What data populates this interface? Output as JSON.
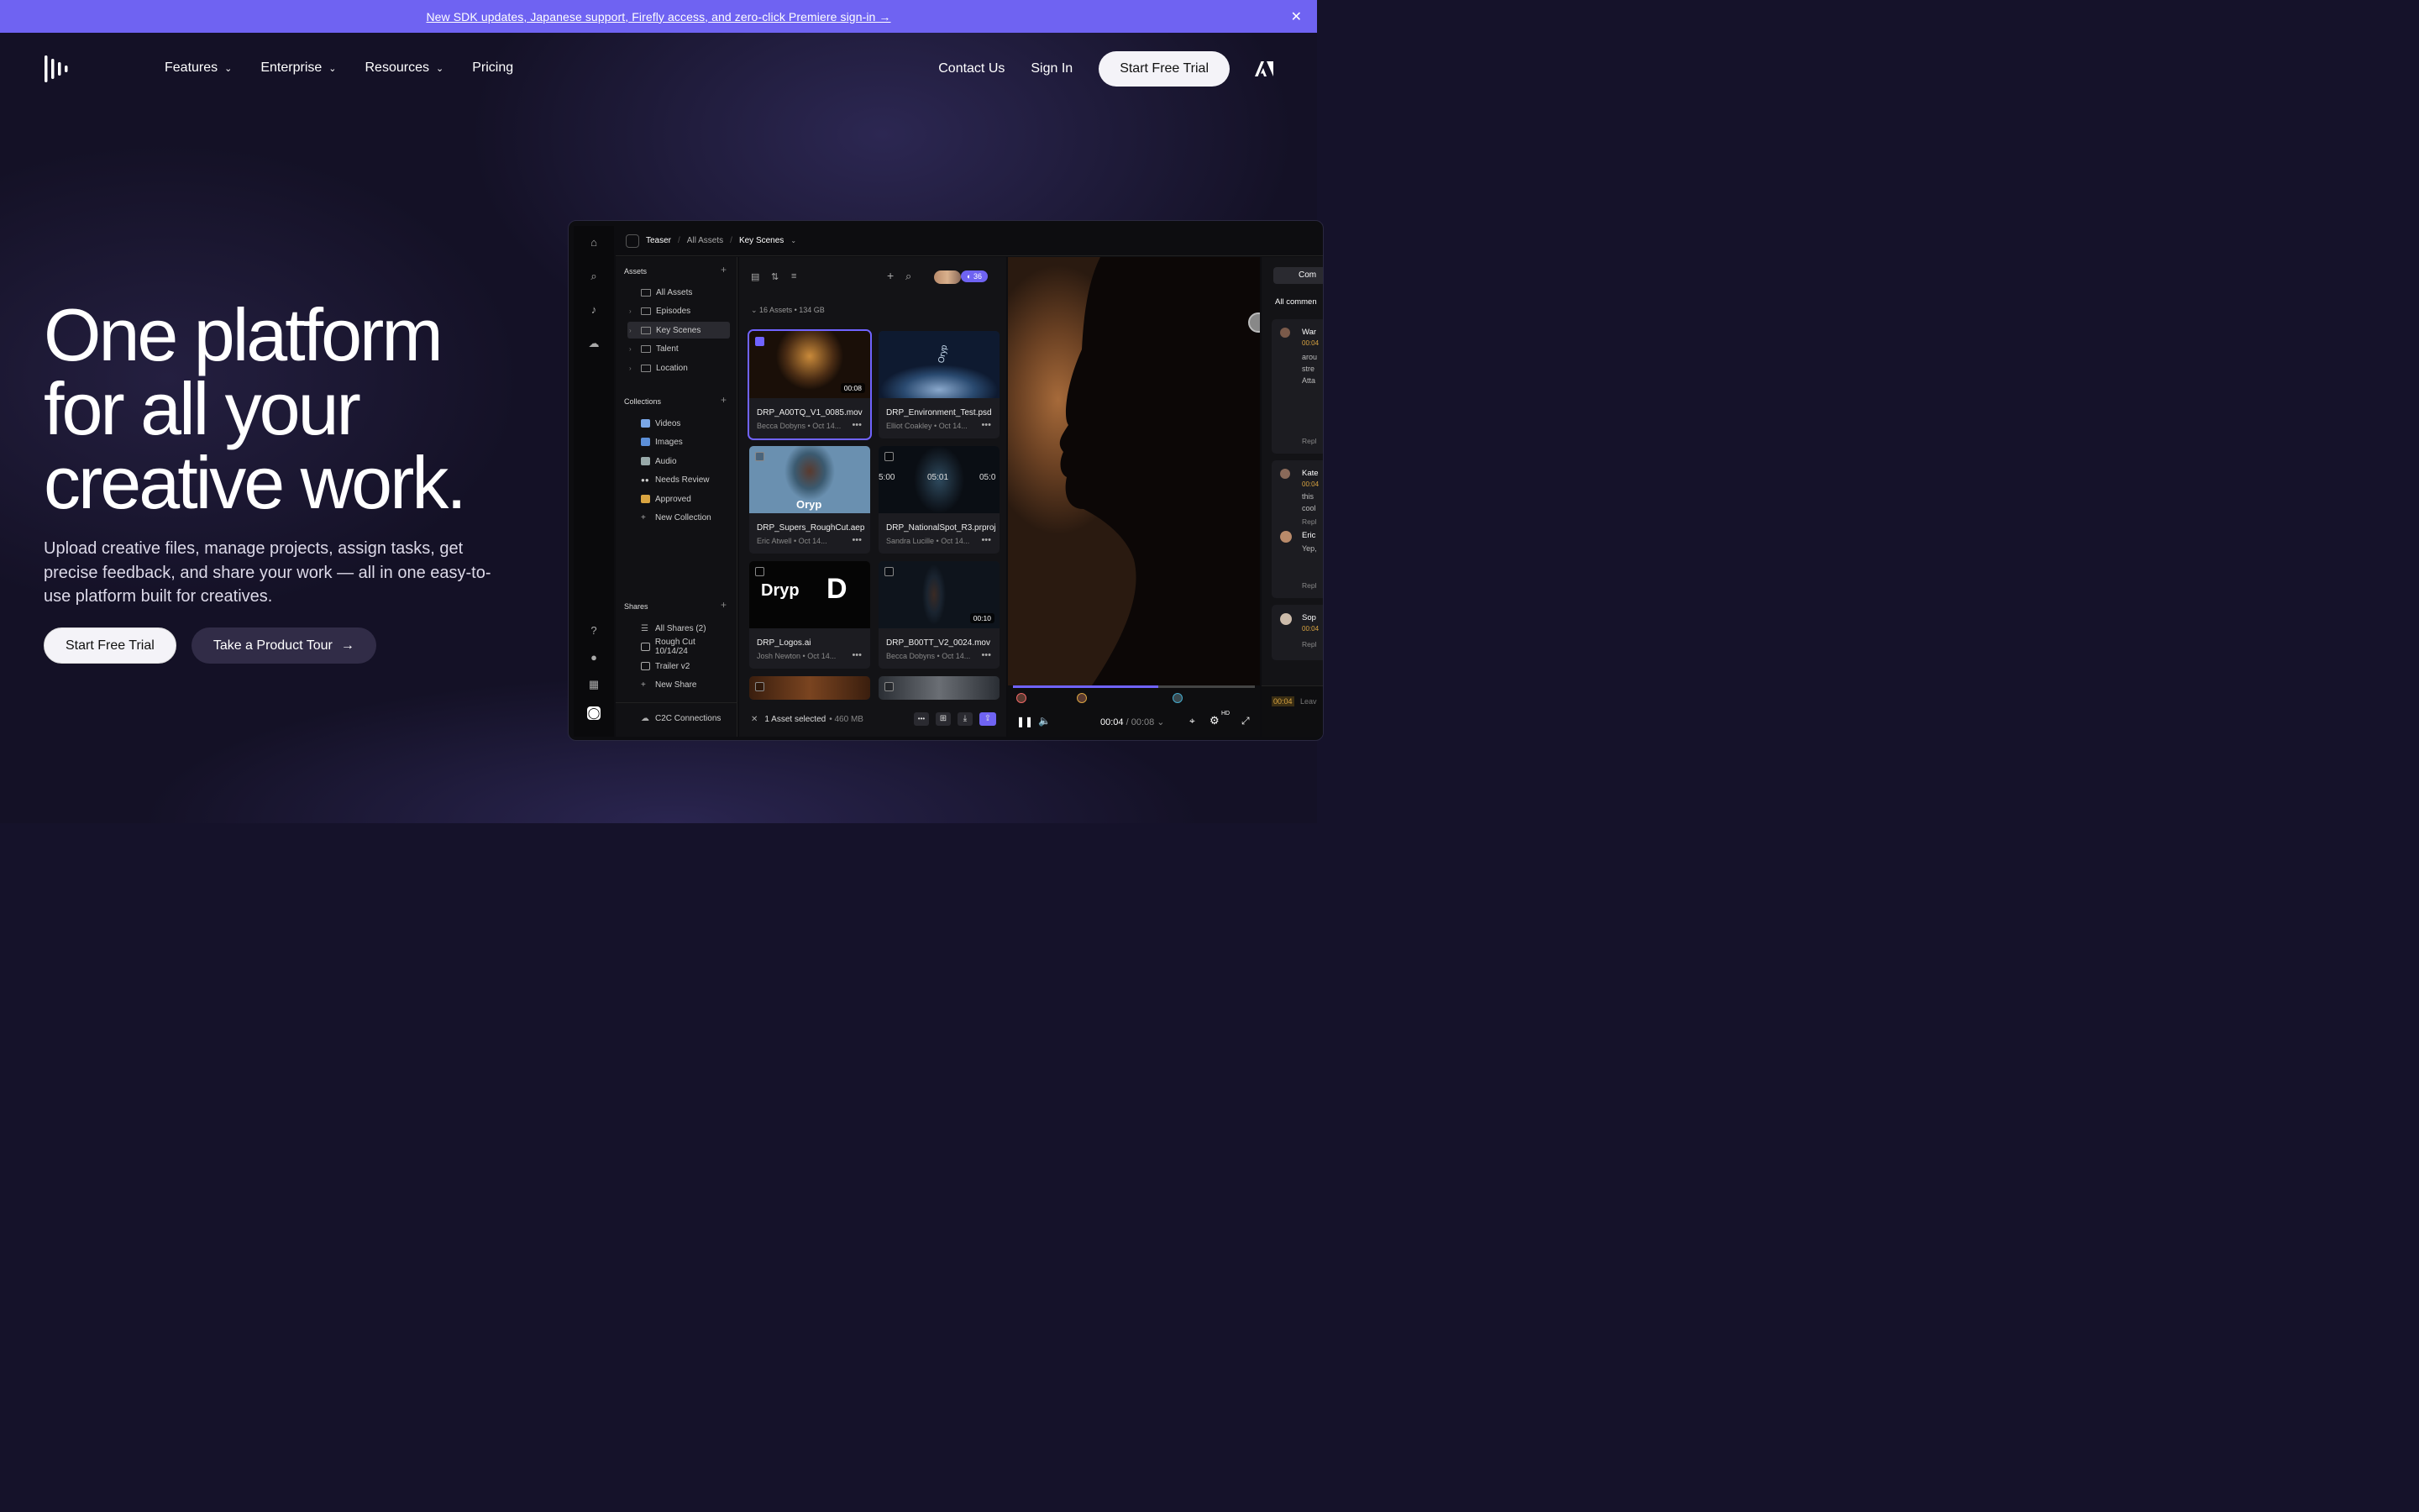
{
  "banner": {
    "text": "New SDK updates, Japanese support, Firefly access, and zero-click Premiere sign-in →",
    "close": "✕"
  },
  "nav": {
    "items": [
      "Features",
      "Enterprise",
      "Resources",
      "Pricing"
    ],
    "contact": "Contact Us",
    "signin": "Sign In",
    "trial": "Start Free Trial"
  },
  "hero": {
    "line1": "One platform",
    "line2": "for all your",
    "line3": "creative work.",
    "sub": "Upload creative files, manage projects, assign tasks, get precise feedback, and share your work — all in one easy-to-use platform built for creatives.",
    "cta1": "Start Free Trial",
    "cta2": "Take a Product Tour",
    "arrow": "→"
  },
  "app": {
    "breadcrumb": {
      "project": "Teaser",
      "sep": "/",
      "all": "All Assets",
      "current": "Key Scenes"
    },
    "assets_label": "Assets",
    "collections_label": "Collections",
    "shares_label": "Shares",
    "folders": [
      "All Assets",
      "Episodes",
      "Key Scenes",
      "Talent",
      "Location"
    ],
    "collections": [
      "Videos",
      "Images",
      "Audio",
      "Needs Review",
      "Approved",
      "New Collection"
    ],
    "shares": [
      "All Shares (2)",
      "Rough Cut 10/14/24",
      "Trailer v2",
      "New Share"
    ],
    "c2c": "C2C Connections",
    "users": "36",
    "asset_count": "16 Assets",
    "asset_size": "134 GB",
    "cards": [
      {
        "name": "DRP_A00TQ_V1_0085.mov",
        "author": "Becca Dobyns",
        "date": "Oct 14...",
        "dur": "00:08"
      },
      {
        "name": "DRP_Environment_Test.psd",
        "author": "Elliot Coakley",
        "date": "Oct 14...",
        "dur": ""
      },
      {
        "name": "DRP_Supers_RoughCut.aep",
        "author": "Eric Atwell",
        "date": "Oct 14...",
        "dur": ""
      },
      {
        "name": "DRP_NationalSpot_R3.prproj",
        "author": "Sandra Lucille",
        "date": "Oct 14...",
        "dur": ""
      },
      {
        "name": "DRP_Logos.ai",
        "author": "Josh Newton",
        "date": "Oct 14...",
        "dur": ""
      },
      {
        "name": "DRP_B00TT_V2_0024.mov",
        "author": "Becca Dobyns",
        "date": "Oct 14...",
        "dur": "00:10"
      }
    ],
    "thumb_text": {
      "oryp": "Oryp",
      "dryp": "Dryp",
      "d": "D",
      "timecodes": [
        "5:00",
        "05:01",
        "05:0"
      ]
    },
    "selection": "1 Asset selected",
    "selection_size": "460 MB",
    "player": {
      "time": "00:04",
      "total": "/ 00:08",
      "hd": "HD"
    },
    "comments": {
      "tab": "Com",
      "all": "All commen",
      "names": [
        "War",
        "Kate",
        "Eric",
        "Sop"
      ],
      "snippets": [
        "arou",
        "stre",
        "Atta",
        "this",
        "cool",
        "Yep,"
      ],
      "reply": "Repl",
      "time": "00:04",
      "leave": "Leav"
    }
  },
  "colors": {
    "banner": "#6f63f2",
    "accent": "#7063ff"
  }
}
